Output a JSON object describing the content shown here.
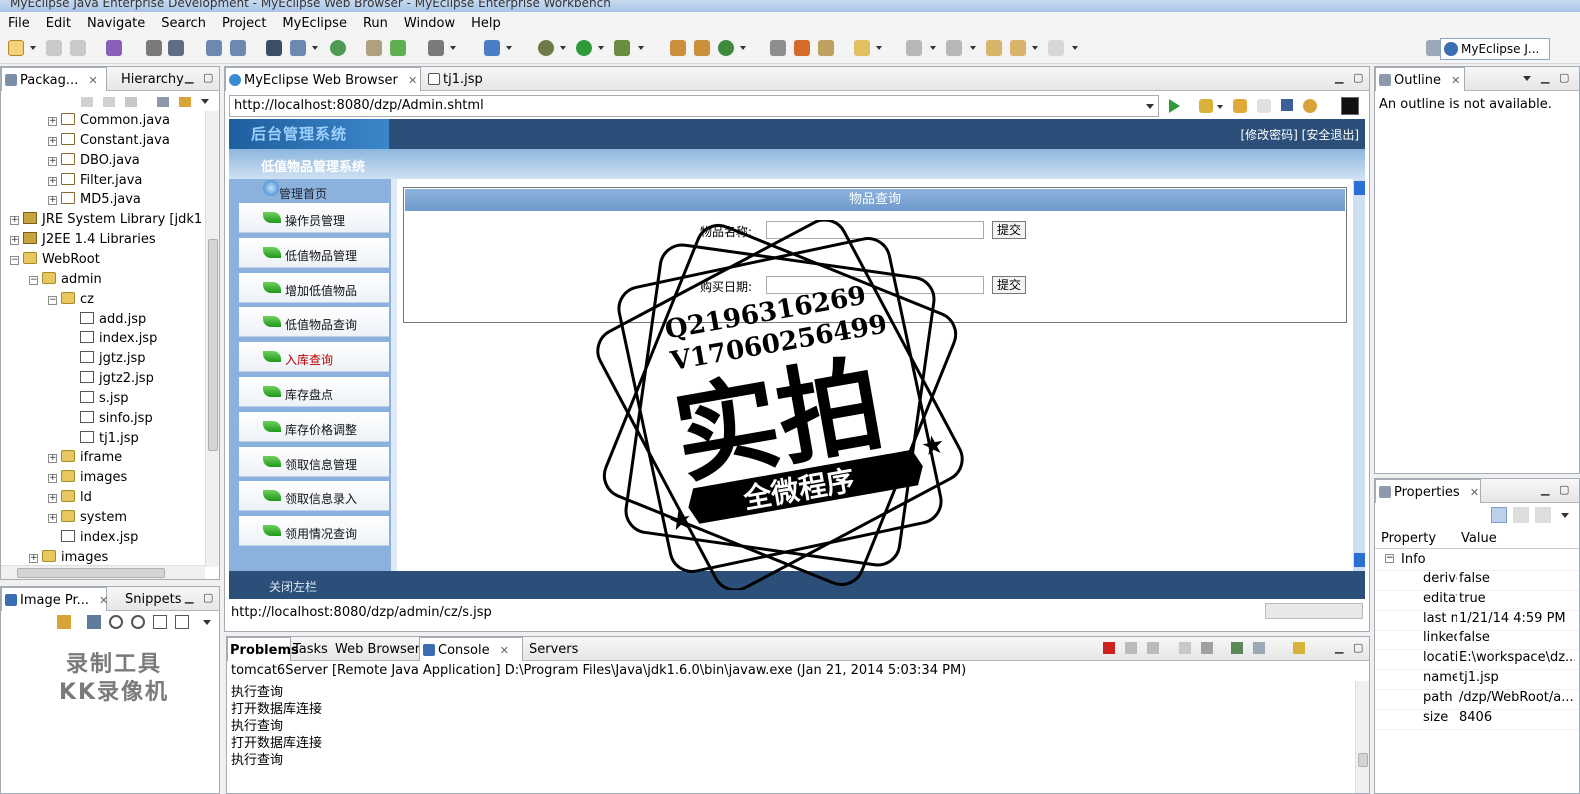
{
  "window": {
    "title": "MyEclipse Java Enterprise Development - MyEclipse Web Browser - MyEclipse Enterprise Workbench"
  },
  "menu": [
    "File",
    "Edit",
    "Navigate",
    "Search",
    "Project",
    "MyEclipse",
    "Run",
    "Window",
    "Help"
  ],
  "perspective": {
    "label": "MyEclipse J..."
  },
  "explorer": {
    "tabs": [
      {
        "label": "Packag..."
      },
      {
        "label": "Hierarchy"
      }
    ],
    "tree": [
      {
        "label": "Common.java",
        "type": "java",
        "indent": 3
      },
      {
        "label": "Constant.java",
        "type": "java",
        "indent": 3
      },
      {
        "label": "DBO.java",
        "type": "java",
        "indent": 3
      },
      {
        "label": "Filter.java",
        "type": "java",
        "indent": 3
      },
      {
        "label": "MD5.java",
        "type": "java",
        "indent": 3
      },
      {
        "label": "JRE System Library [jdk1",
        "type": "lib",
        "indent": 1
      },
      {
        "label": "J2EE 1.4 Libraries",
        "type": "lib",
        "indent": 1
      },
      {
        "label": "WebRoot",
        "type": "folder",
        "indent": 1,
        "open": true
      },
      {
        "label": "admin",
        "type": "folder",
        "indent": 2,
        "open": true
      },
      {
        "label": "cz",
        "type": "folder",
        "indent": 3,
        "open": true
      },
      {
        "label": "add.jsp",
        "type": "jsp",
        "indent": 4
      },
      {
        "label": "index.jsp",
        "type": "jsp",
        "indent": 4
      },
      {
        "label": "jgtz.jsp",
        "type": "jsp",
        "indent": 4
      },
      {
        "label": "jgtz2.jsp",
        "type": "jsp",
        "indent": 4
      },
      {
        "label": "s.jsp",
        "type": "jsp",
        "indent": 4
      },
      {
        "label": "sinfo.jsp",
        "type": "jsp",
        "indent": 4
      },
      {
        "label": "tj1.jsp",
        "type": "jsp",
        "indent": 4
      },
      {
        "label": "iframe",
        "type": "folder",
        "indent": 3
      },
      {
        "label": "images",
        "type": "folder",
        "indent": 3
      },
      {
        "label": "ld",
        "type": "folder",
        "indent": 3
      },
      {
        "label": "system",
        "type": "folder",
        "indent": 3
      },
      {
        "label": "index.jsp",
        "type": "jsp",
        "indent": 3
      },
      {
        "label": "images",
        "type": "folder",
        "indent": 2
      }
    ]
  },
  "imagePreview": {
    "tabs": [
      {
        "label": "Image Pr..."
      },
      {
        "label": "Snippets"
      }
    ]
  },
  "editor": {
    "tabs": [
      {
        "label": "MyEclipse Web Browser"
      },
      {
        "label": "tj1.jsp"
      }
    ],
    "url": "http://localhost:8080/dzp/Admin.shtml",
    "status_url": "http://localhost:8080/dzp/admin/cz/s.jsp"
  },
  "webpage": {
    "logo": "后台管理系统",
    "top_links": "[修改密码] [安全退出]",
    "subtitle": "低值物品管理系统",
    "home": "管理首页",
    "nav": [
      {
        "label": "操作员管理"
      },
      {
        "label": "低值物品管理"
      },
      {
        "label": "增加低值物品"
      },
      {
        "label": "低值物品查询"
      },
      {
        "label": "入库查询",
        "active": true
      },
      {
        "label": "库存盘点"
      },
      {
        "label": "库存价格调整"
      },
      {
        "label": "领取信息管理"
      },
      {
        "label": "领取信息录入"
      },
      {
        "label": "领用情况查询"
      }
    ],
    "close_left": "关闭左栏",
    "query": {
      "title": "物品查询",
      "name_label": "物品名称:",
      "date_label": "购买日期:",
      "submit": "提交"
    }
  },
  "outline": {
    "tab": "Outline",
    "message": "An outline is not available."
  },
  "properties": {
    "tab": "Properties",
    "header": {
      "property": "Property",
      "value": "Value"
    },
    "group": "Info",
    "rows": [
      {
        "key": "derive",
        "value": "false"
      },
      {
        "key": "editat",
        "value": "true"
      },
      {
        "key": "last m",
        "value": "1/21/14 4:59 PM"
      },
      {
        "key": "linked",
        "value": "false"
      },
      {
        "key": "locatic",
        "value": "E:\\workspace\\dz..."
      },
      {
        "key": "name",
        "value": "tj1.jsp"
      },
      {
        "key": "path",
        "value": "/dzp/WebRoot/a..."
      },
      {
        "key": "size",
        "value": "8406"
      }
    ]
  },
  "console": {
    "tabs": [
      {
        "label": "Problems"
      },
      {
        "label": "Tasks"
      },
      {
        "label": "Web Browser"
      },
      {
        "label": "Console"
      },
      {
        "label": "Servers"
      }
    ],
    "header": "tomcat6Server [Remote Java Application] D:\\Program Files\\Java\\jdk1.6.0\\bin\\javaw.exe (Jan 21, 2014 5:03:34 PM)",
    "lines": [
      "执行查询",
      "打开数据库连接",
      "执行查询",
      "打开数据库连接",
      "执行查询"
    ]
  },
  "watermark": {
    "line1": "Q2196316269",
    "line2": "V17060256499",
    "big": "实拍",
    "banner": "全微程序"
  },
  "recorder": {
    "line1": "录制工具",
    "line2": "KK录像机"
  },
  "colors": {
    "banner": "#2b4f78",
    "sidebar": "#8bb2dc",
    "accent": "#3a6db3"
  }
}
